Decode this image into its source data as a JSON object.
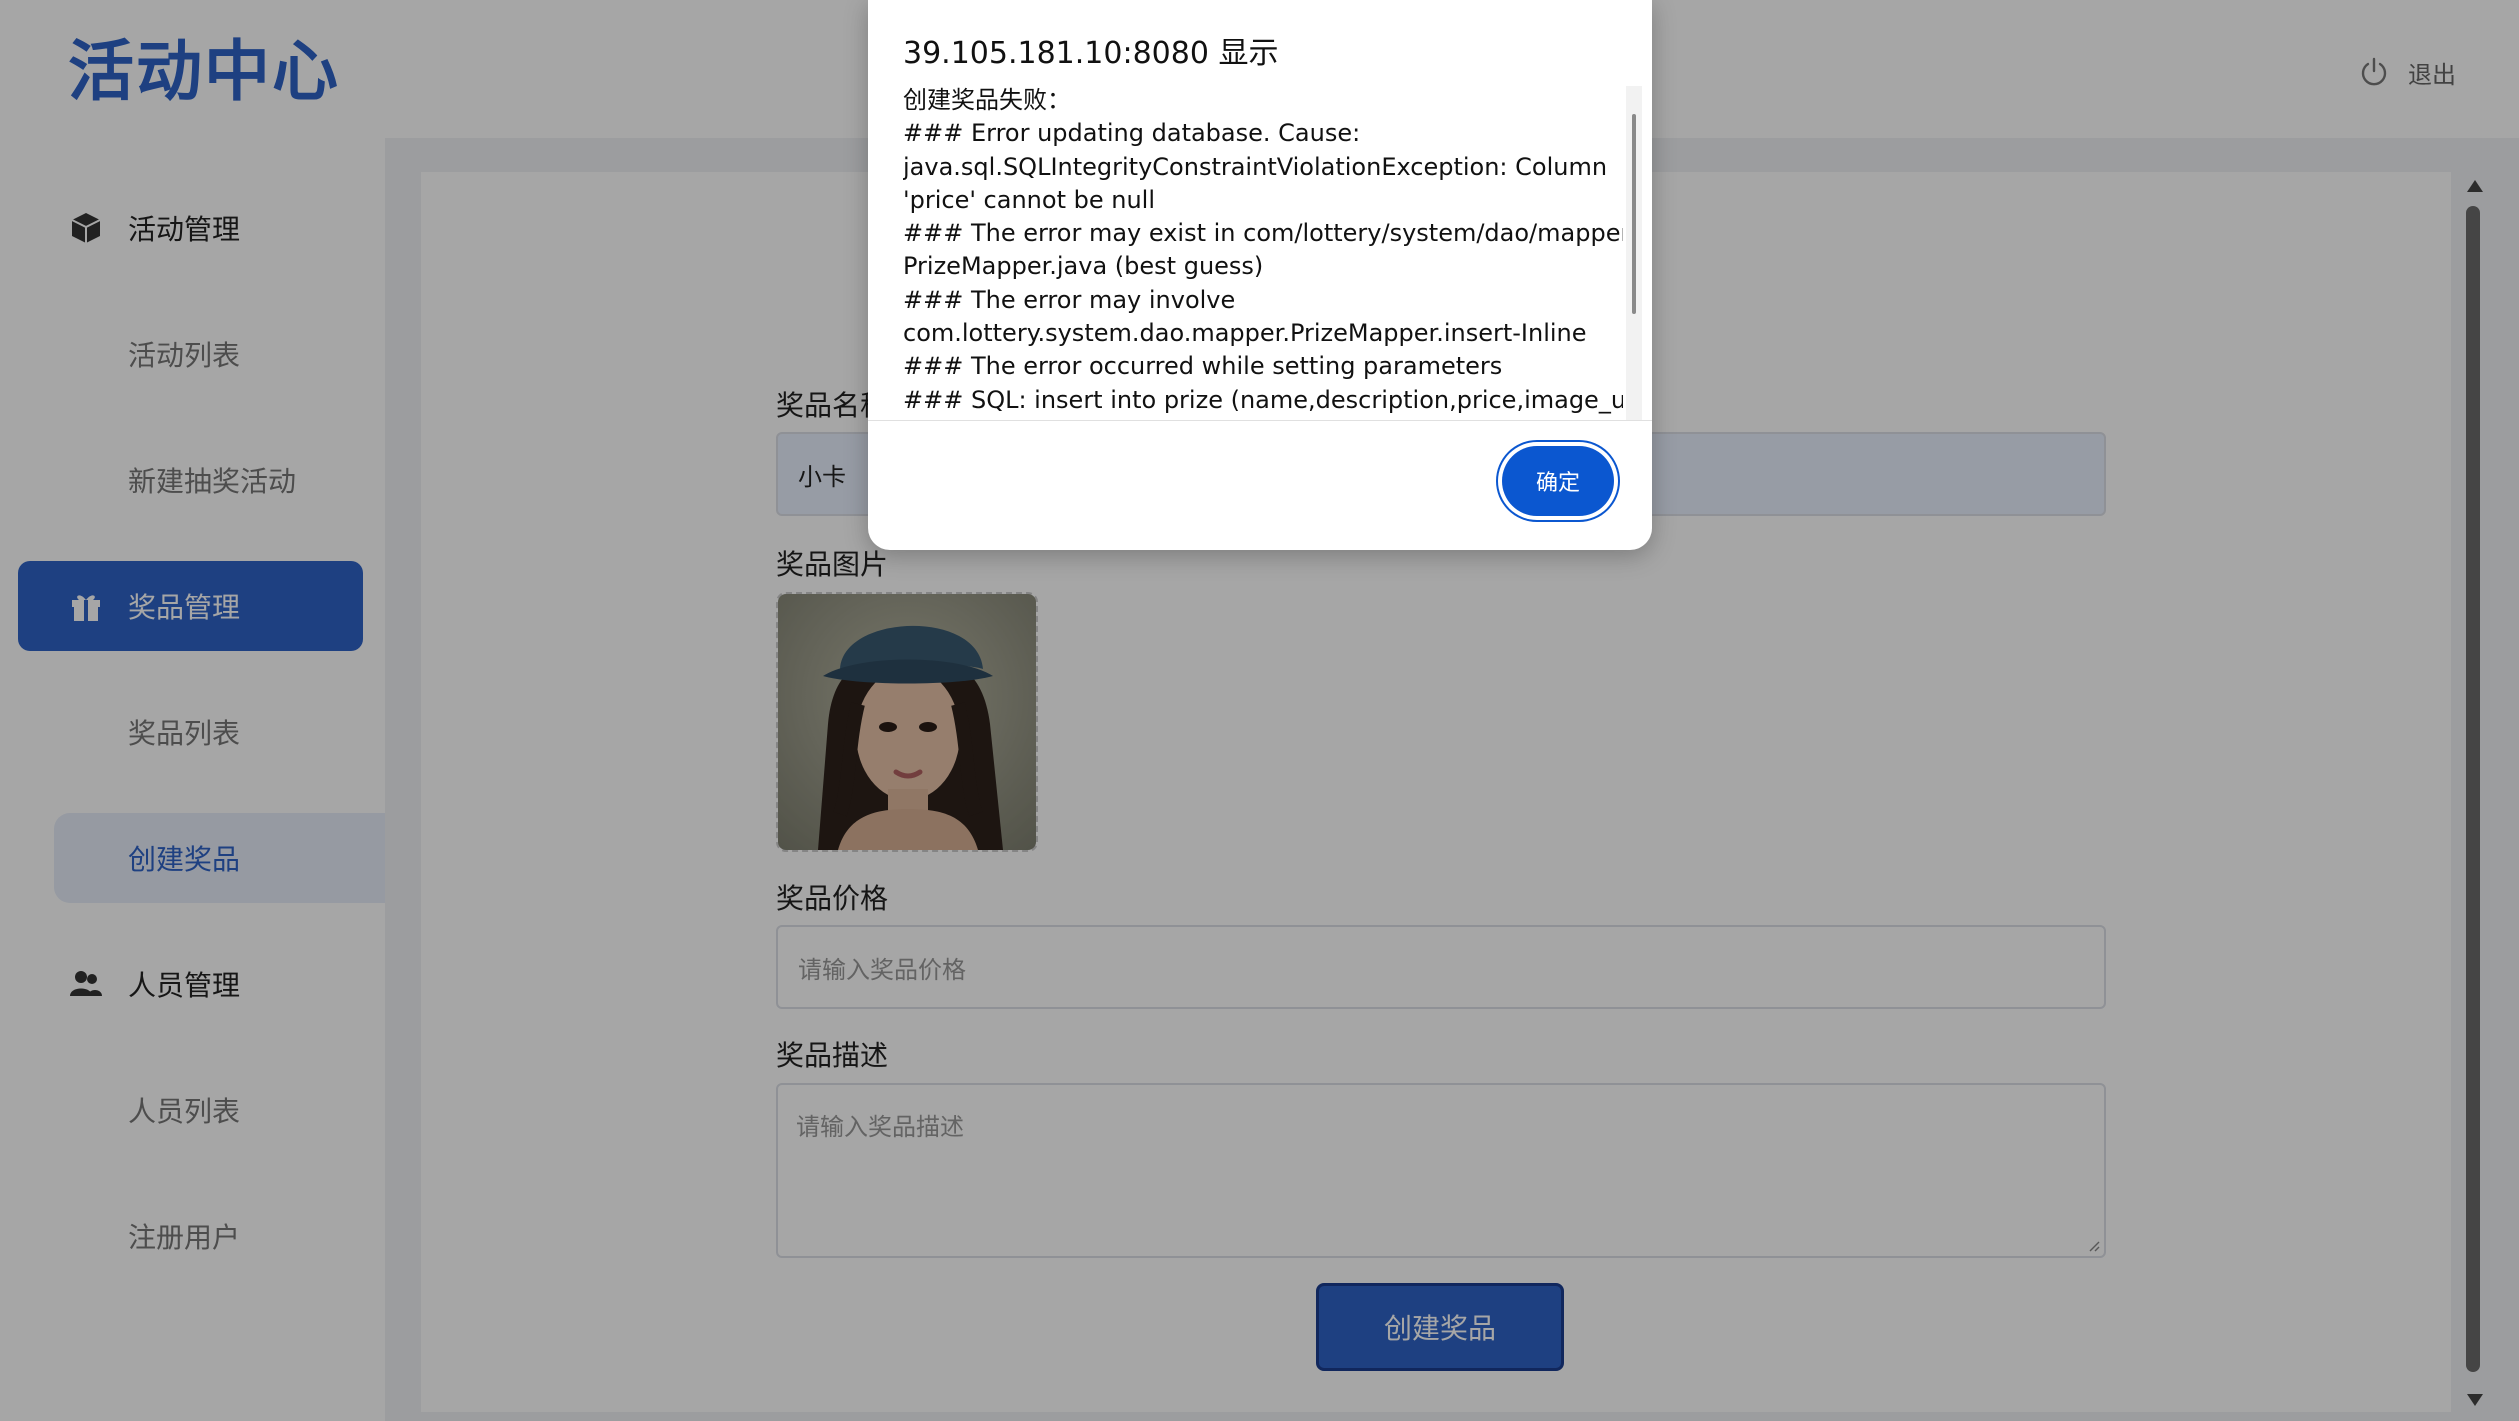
{
  "header": {
    "logo": "活动中心",
    "logout_label": "退出"
  },
  "sidebar": {
    "items": [
      {
        "label": "活动管理",
        "type": "parent",
        "icon": "cube-icon",
        "active": false
      },
      {
        "label": "活动列表",
        "type": "child",
        "active": false
      },
      {
        "label": "新建抽奖活动",
        "type": "child",
        "active": false
      },
      {
        "label": "奖品管理",
        "type": "parent",
        "icon": "gift-icon",
        "active": true
      },
      {
        "label": "奖品列表",
        "type": "child",
        "active": false
      },
      {
        "label": "创建奖品",
        "type": "child",
        "active": true
      },
      {
        "label": "人员管理",
        "type": "parent",
        "icon": "users-icon",
        "active": false
      },
      {
        "label": "人员列表",
        "type": "child",
        "active": false
      },
      {
        "label": "注册用户",
        "type": "child",
        "active": false
      }
    ]
  },
  "form": {
    "name_label": "奖品名称",
    "name_value": "小卡",
    "image_label": "奖品图片",
    "price_label": "奖品价格",
    "price_placeholder": "请输入奖品价格",
    "desc_label": "奖品描述",
    "desc_placeholder": "请输入奖品描述",
    "submit_label": "创建奖品"
  },
  "dialog": {
    "title": "39.105.181.10:8080 显示",
    "lines": [
      "创建奖品失败：",
      "### Error updating database.  Cause:",
      "java.sql.SQLIntegrityConstraintViolationException: Column",
      "'price' cannot be null",
      "### The error may exist in com/lottery/system/dao/mapper/",
      "PrizeMapper.java (best guess)",
      "### The error may involve",
      "com.lottery.system.dao.mapper.PrizeMapper.insert-Inline",
      "### The error occurred while setting parameters",
      "### SQL: insert into prize (name,description,price,image_url)"
    ],
    "ok_label": "确定"
  },
  "colors": {
    "brand": "#2f63c7",
    "dialog_button": "#0b57d0"
  }
}
